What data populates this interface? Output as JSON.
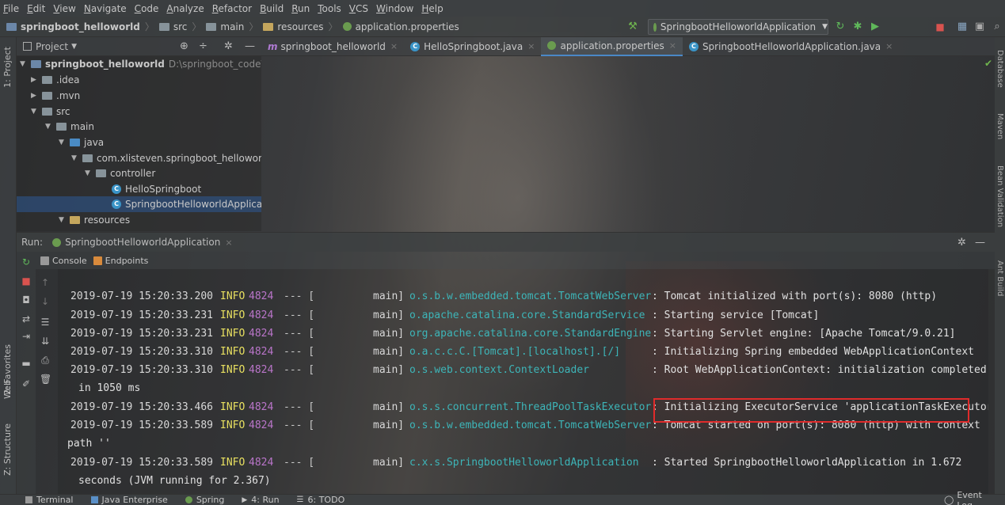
{
  "menu": [
    "File",
    "Edit",
    "View",
    "Navigate",
    "Code",
    "Analyze",
    "Refactor",
    "Build",
    "Run",
    "Tools",
    "VCS",
    "Window",
    "Help"
  ],
  "breadcrumb": [
    "springboot_helloworld",
    "src",
    "main",
    "resources",
    "application.properties"
  ],
  "run_config": "SpringbootHelloworldApplication",
  "left_tabs": {
    "project": "1: Project",
    "favorites": "2: Favorites",
    "web": "Web",
    "structure": "Z: Structure"
  },
  "right_tabs": {
    "database": "Database",
    "maven": "Maven",
    "bean": "Bean Validation",
    "ant": "Ant Build"
  },
  "project_panel": {
    "title": "Project",
    "tree": [
      {
        "label": "springboot_helloworld",
        "extra": "D:\\springboot_code\\spri"
      },
      {
        "label": ".idea"
      },
      {
        "label": ".mvn"
      },
      {
        "label": "src"
      },
      {
        "label": "main"
      },
      {
        "label": "java"
      },
      {
        "label": "com.xlisteven.springboot_helloworld"
      },
      {
        "label": "controller"
      },
      {
        "label": "HelloSpringboot"
      },
      {
        "label": "SpringbootHelloworldApplication"
      },
      {
        "label": "resources"
      }
    ]
  },
  "editor_tabs": [
    {
      "label": "springboot_helloworld"
    },
    {
      "label": "HelloSpringboot.java"
    },
    {
      "label": "application.properties"
    },
    {
      "label": "SpringbootHelloworldApplication.java"
    }
  ],
  "run_panel": {
    "label": "Run:",
    "config": "SpringbootHelloworldApplication",
    "subtabs": [
      "Console",
      "Endpoints"
    ]
  },
  "console_lines": [
    {
      "ts": "2019-07-19 15:20:33.200",
      "level": "INFO",
      "pid": "4824",
      "dash": "--- [",
      "thread": "main]",
      "logger": "o.s.b.w.embedded.tomcat.TomcatWebServer",
      "msg": ": Tomcat initialized with port(s): 8080 (http)"
    },
    {
      "ts": "2019-07-19 15:20:33.231",
      "level": "INFO",
      "pid": "4824",
      "dash": "--- [",
      "thread": "main]",
      "logger": "o.apache.catalina.core.StandardService",
      "msg": ": Starting service [Tomcat]"
    },
    {
      "ts": "2019-07-19 15:20:33.231",
      "level": "INFO",
      "pid": "4824",
      "dash": "--- [",
      "thread": "main]",
      "logger": "org.apache.catalina.core.StandardEngine",
      "msg": ": Starting Servlet engine: [Apache Tomcat/9.0.21]"
    },
    {
      "ts": "2019-07-19 15:20:33.310",
      "level": "INFO",
      "pid": "4824",
      "dash": "--- [",
      "thread": "main]",
      "logger": "o.a.c.c.C.[Tomcat].[localhost].[/]",
      "msg": ": Initializing Spring embedded WebApplicationContext"
    },
    {
      "ts": "2019-07-19 15:20:33.310",
      "level": "INFO",
      "pid": "4824",
      "dash": "--- [",
      "thread": "main]",
      "logger": "o.s.web.context.ContextLoader",
      "msg": ": Root WebApplicationContext: initialization completed"
    },
    {
      "cont": "in 1050 ms"
    },
    {
      "ts": "2019-07-19 15:20:33.466",
      "level": "INFO",
      "pid": "4824",
      "dash": "--- [",
      "thread": "main]",
      "logger": "o.s.s.concurrent.ThreadPoolTaskExecutor",
      "msg": ": Initializing ExecutorService 'applicationTaskExecutor'"
    },
    {
      "ts": "2019-07-19 15:20:33.589",
      "level": "INFO",
      "pid": "4824",
      "dash": "--- [",
      "thread": "main]",
      "logger": "o.s.b.w.embedded.tomcat.TomcatWebServer",
      "msg": ": Tomcat started on port(s): 8080 (http) with context"
    },
    {
      "cont": "path ''"
    },
    {
      "ts": "2019-07-19 15:20:33.589",
      "level": "INFO",
      "pid": "4824",
      "dash": "--- [",
      "thread": "main]",
      "logger": "c.x.s.SpringbootHelloworldApplication",
      "msg": ": Started SpringbootHelloworldApplication in 1.672"
    },
    {
      "cont": "seconds (JVM running for 2.367)"
    }
  ],
  "status_bar": [
    "Terminal",
    "Java Enterprise",
    "Spring",
    "4: Run",
    "6: TODO",
    "Event Log"
  ],
  "colors": {
    "highlight": "#e02b2b",
    "level": "#e8e060",
    "pid": "#b975c9",
    "logger": "#3db5b8"
  }
}
